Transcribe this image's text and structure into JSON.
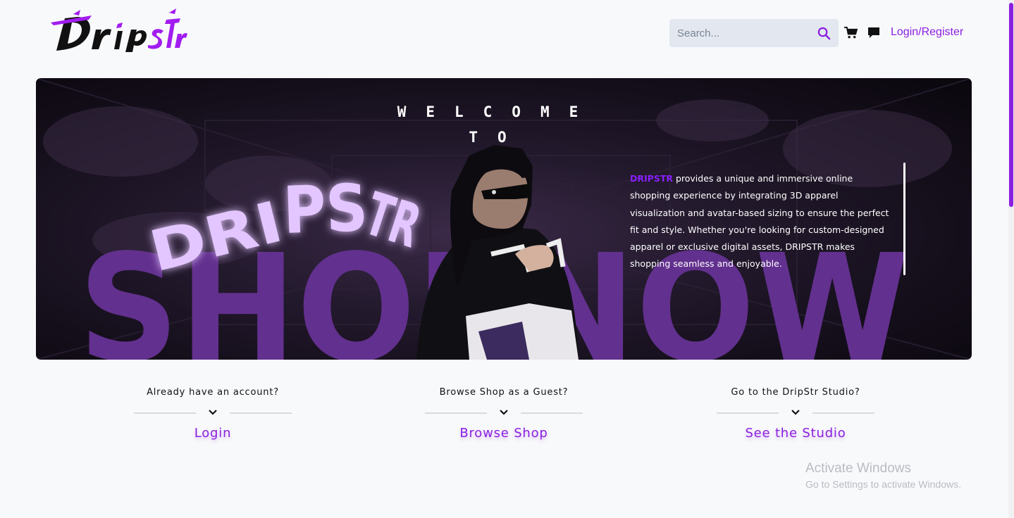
{
  "header": {
    "logo_text": "Dripstr",
    "search": {
      "placeholder": "Search...",
      "value": ""
    },
    "login_label": "Login/Register"
  },
  "hero": {
    "welcome_line1": "WELCOME",
    "welcome_line2": "TO",
    "logo_text": "DRIPSTR",
    "bg_text": "SHOPNOW",
    "tagline_brand": "DRIPSTR",
    "tagline_body": " provides a unique and immersive online shopping experience by integrating 3D apparel visualization and avatar-based sizing to ensure the perfect fit and style. Whether you're looking for custom-designed apparel or exclusive digital assets, DRIPSTR makes shopping seamless and enjoyable."
  },
  "options": [
    {
      "question": "Already have an account?",
      "link": "Login"
    },
    {
      "question": "Browse Shop as a Guest?",
      "link": "Browse Shop"
    },
    {
      "question": "Go to the DripStr Studio?",
      "link": "See the Studio"
    }
  ],
  "watermark": {
    "title": "Activate Windows",
    "subtitle": "Go to Settings to activate Windows."
  },
  "icons": [
    "search-icon",
    "cart-icon",
    "chat-icon",
    "chevron-down-icon"
  ],
  "colors": {
    "accent": "#8b1fe0",
    "hero_purple": "#5c2a85",
    "hero_logo": "#e3c6ff",
    "background": "#f8f9fb"
  }
}
